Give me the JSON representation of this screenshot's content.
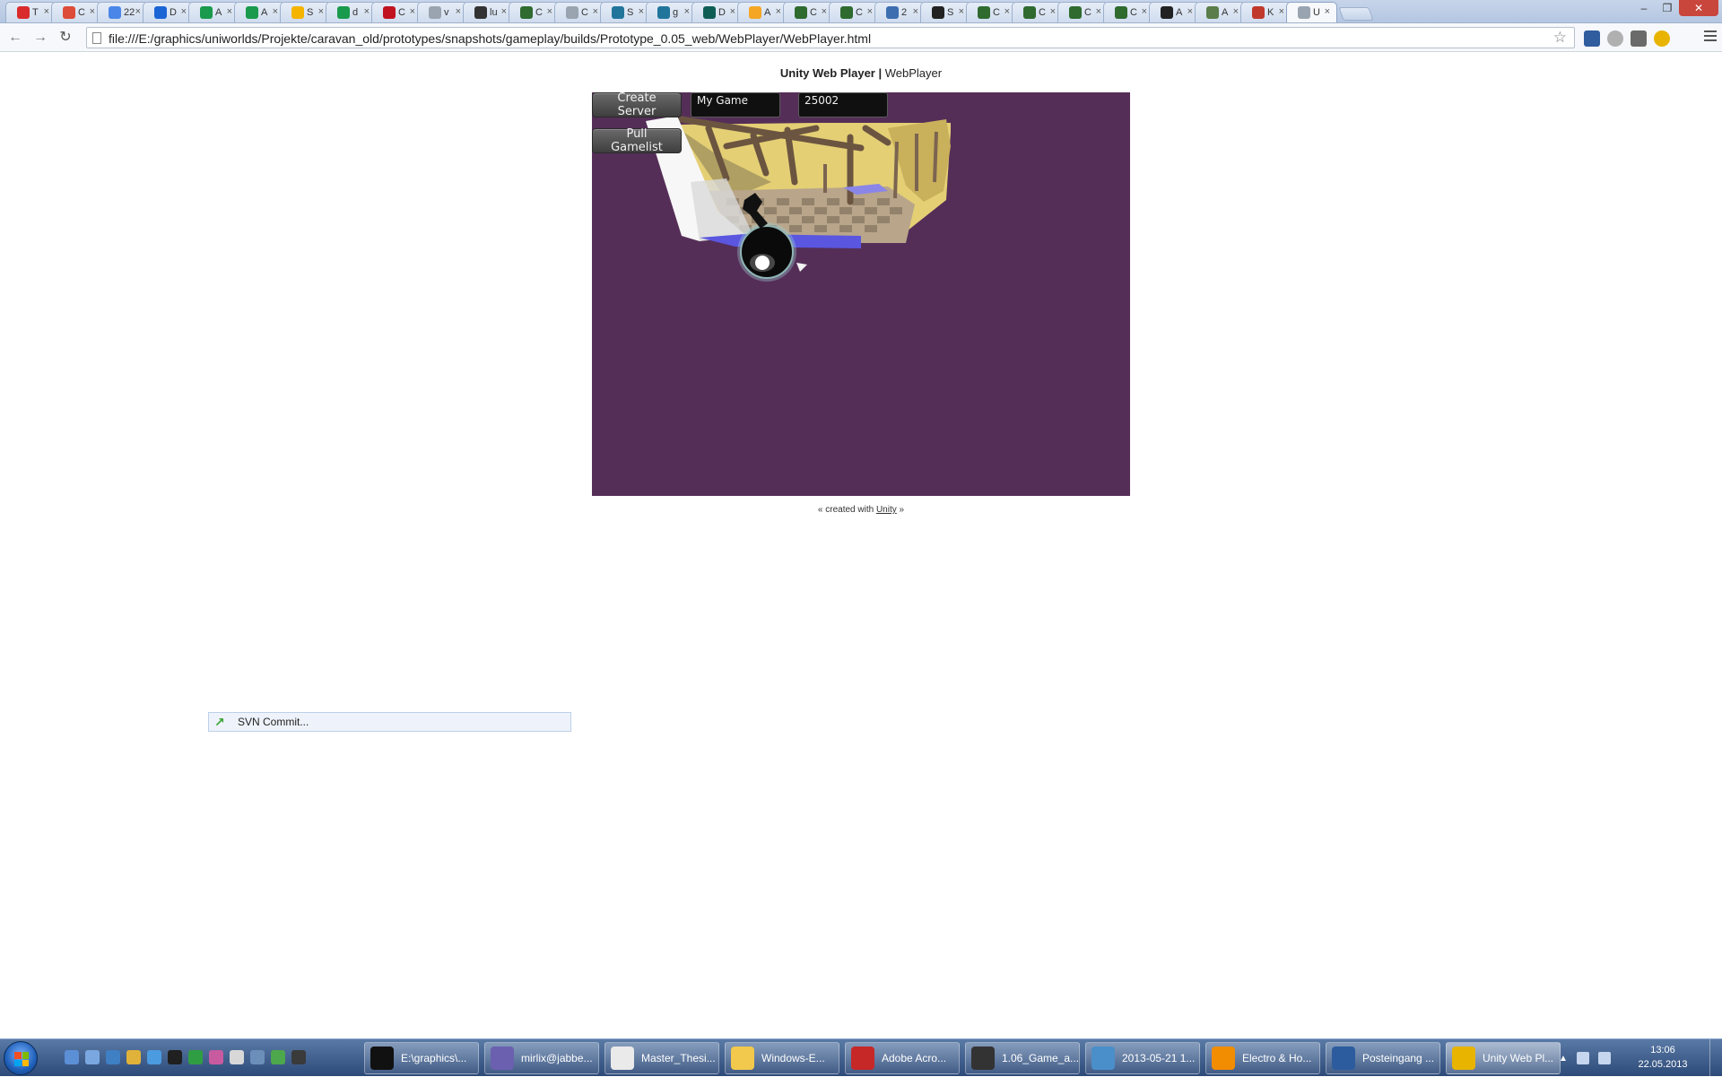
{
  "browser": {
    "tabs": [
      {
        "icon": "youtube-icon",
        "title": "T",
        "color": "#d92b2b"
      },
      {
        "icon": "google-plus-icon",
        "title": "C",
        "color": "#dd4b39"
      },
      {
        "icon": "calendar-icon",
        "title": "22 -",
        "color": "#4a86e8"
      },
      {
        "icon": "d-app-icon",
        "title": "D",
        "color": "#1b64d6"
      },
      {
        "icon": "spreadsheet-icon",
        "title": "A",
        "color": "#1a9a4c"
      },
      {
        "icon": "spreadsheet-icon",
        "title": "A",
        "color": "#1a9a4c"
      },
      {
        "icon": "drive-icon",
        "title": "S",
        "color": "#f4b400"
      },
      {
        "icon": "spreadsheet-icon",
        "title": "d",
        "color": "#1a9a4c"
      },
      {
        "icon": "record-icon",
        "title": "C",
        "color": "#c1121f"
      },
      {
        "icon": "page-icon",
        "title": "v",
        "color": "#9aa4b0"
      },
      {
        "icon": "avatar-icon",
        "title": "lu",
        "color": "#333333"
      },
      {
        "icon": "cube-icon",
        "title": "C",
        "color": "#2f6a2f"
      },
      {
        "icon": "page-icon",
        "title": "C",
        "color": "#9aa4b0"
      },
      {
        "icon": "wordpress-icon",
        "title": "S",
        "color": "#21759b"
      },
      {
        "icon": "wordpress-icon",
        "title": "g",
        "color": "#21759b"
      },
      {
        "icon": "d-app-icon",
        "title": "D",
        "color": "#0e5d55"
      },
      {
        "icon": "swirl-icon",
        "title": "A",
        "color": "#f5a623"
      },
      {
        "icon": "cube-icon",
        "title": "C",
        "color": "#2f6a2f"
      },
      {
        "icon": "cube-icon",
        "title": "C",
        "color": "#2f6a2f"
      },
      {
        "icon": "bird-icon",
        "title": "2",
        "color": "#3d6fb0"
      },
      {
        "icon": "eye-icon",
        "title": "S",
        "color": "#222222"
      },
      {
        "icon": "cube-icon",
        "title": "C",
        "color": "#2f6a2f"
      },
      {
        "icon": "cube-icon",
        "title": "C",
        "color": "#2f6a2f"
      },
      {
        "icon": "cube-icon",
        "title": "C",
        "color": "#2f6a2f"
      },
      {
        "icon": "cube-icon",
        "title": "C",
        "color": "#2f6a2f"
      },
      {
        "icon": "penguin-icon",
        "title": "A",
        "color": "#222222"
      },
      {
        "icon": "image-icon",
        "title": "A",
        "color": "#5a7d4a"
      },
      {
        "icon": "k-icon",
        "title": "K",
        "color": "#c0392b"
      },
      {
        "icon": "page-icon",
        "title": "U",
        "color": "#9aa4b0",
        "active": true
      }
    ],
    "url": "file:///E:/graphics/uniworlds/Projekte/caravan_old/prototypes/snapshots/gameplay/builds/Prototype_0.05_web/WebPlayer/WebPlayer.html",
    "extensions": [
      {
        "icon": "xdk-icon",
        "color": "#2f5d9e"
      },
      {
        "icon": "shield-icon",
        "color": "#b0b0b0"
      },
      {
        "icon": "download-icon",
        "color": "#6a6a6a"
      },
      {
        "icon": "chrome-color-icon",
        "color": "#e8b400"
      }
    ],
    "back_symbol": "←",
    "forward_symbol": "→",
    "reload_symbol": "↻",
    "star_symbol": "☆",
    "close_symbol": "×",
    "window_controls": {
      "minimize": "–",
      "maximize": "❐",
      "close": "✕"
    }
  },
  "page": {
    "title_bold": "Unity Web Player",
    "title_sep": " | ",
    "title_rest": "WebPlayer",
    "game": {
      "create_server_label": "Create Server",
      "pull_gamelist_label": "Pull Gamelist",
      "game_name_value": "My Game",
      "port_value": "25002",
      "background_color": "#552e58"
    },
    "footer_prefix": "« created with ",
    "footer_link": "Unity",
    "footer_suffix": " »",
    "svn_tooltip": "SVN Commit..."
  },
  "taskbar": {
    "quick_launch_colors": [
      "#5b8fd6",
      "#7aa7e0",
      "#3f7fc4",
      "#e0b23a",
      "#4b9be0",
      "#202020",
      "#2f9e43",
      "#c85aa0",
      "#d8d8d8",
      "#6b8fb8",
      "#4da84d",
      "#3a3a3a"
    ],
    "tasks": [
      {
        "label": "E:\\graphics\\...",
        "icon": "xnview-icon",
        "color": "#111111"
      },
      {
        "label": "mirlix@jabbe...",
        "icon": "pidgin-icon",
        "color": "#6b5fb0"
      },
      {
        "label": "Master_Thesi...",
        "icon": "document-icon",
        "color": "#eaeaea"
      },
      {
        "label": "Windows-E...",
        "icon": "folder-icon",
        "color": "#f2c94c"
      },
      {
        "label": "Adobe Acro...",
        "icon": "acrobat-icon",
        "color": "#c62828"
      },
      {
        "label": "1.06_Game_a...",
        "icon": "inkscape-icon",
        "color": "#333333"
      },
      {
        "label": "2013-05-21 1...",
        "icon": "photo-icon",
        "color": "#4a8fc9"
      },
      {
        "label": "Electro & Ho...",
        "icon": "vlc-icon",
        "color": "#f28c00"
      },
      {
        "label": "Posteingang ...",
        "icon": "thunderbird-icon",
        "color": "#2d5c9e"
      },
      {
        "label": "Unity Web Pl...",
        "icon": "chrome-icon",
        "color": "#e8b400",
        "active": true
      }
    ],
    "time": "13:06",
    "date": "22.05.2013"
  }
}
